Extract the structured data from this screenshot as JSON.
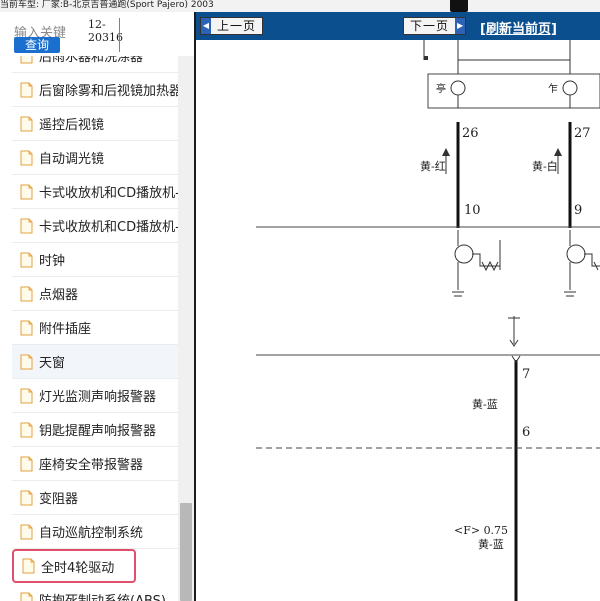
{
  "topbar": {
    "text": "当前车型:  厂家:B-北京吉普通跑(Sport Pajero) 2003"
  },
  "search": {
    "placeholder": "输入关键",
    "button_label": "查询",
    "date_line1": "12-",
    "date_line2": "20316"
  },
  "tree": {
    "items": [
      {
        "label": "后雨水器和洗涤器"
      },
      {
        "label": "后窗除雾和后视镜加热器"
      },
      {
        "label": "遥控后视镜"
      },
      {
        "label": "自动调光镜"
      },
      {
        "label": "卡式收放机和CD播放机-"
      },
      {
        "label": "卡式收放机和CD播放机-"
      },
      {
        "label": "时钟"
      },
      {
        "label": "点烟器"
      },
      {
        "label": "附件插座"
      },
      {
        "label": "天窗"
      },
      {
        "label": "灯光监测声响报警器"
      },
      {
        "label": "钥匙提醒声响报警器"
      },
      {
        "label": "座椅安全带报警器"
      },
      {
        "label": "变阻器"
      },
      {
        "label": "自动巡航控制系统"
      },
      {
        "label": "全时4轮驱动"
      },
      {
        "label": "防抱死制动系统(ABS)"
      }
    ],
    "active_index": 9,
    "selected_index": 15
  },
  "nav": {
    "prev_label": "上一页",
    "next_label": "下一页",
    "refresh_label": "[刷新当前页]"
  },
  "diagram": {
    "pin_left_top": "26",
    "pin_right_top": "27",
    "wire_left": "黄-红",
    "wire_right": "黄-白",
    "pin_left_bottom": "10",
    "pin_right_bottom": "9",
    "pin_center_top": "7",
    "wire_center": "黄-蓝",
    "pin_center_mid": "6",
    "spec_center": "<F> 0.75",
    "wire_center_2": "黄-蓝"
  },
  "colors": {
    "nav_bg": "#0b4f8f",
    "button_blue": "#1a6fcf",
    "selected_border": "#e0506a"
  },
  "icons": {
    "item_icon": "document-icon",
    "prev_arrow": "arrow-left-icon",
    "next_arrow": "arrow-right-icon"
  }
}
